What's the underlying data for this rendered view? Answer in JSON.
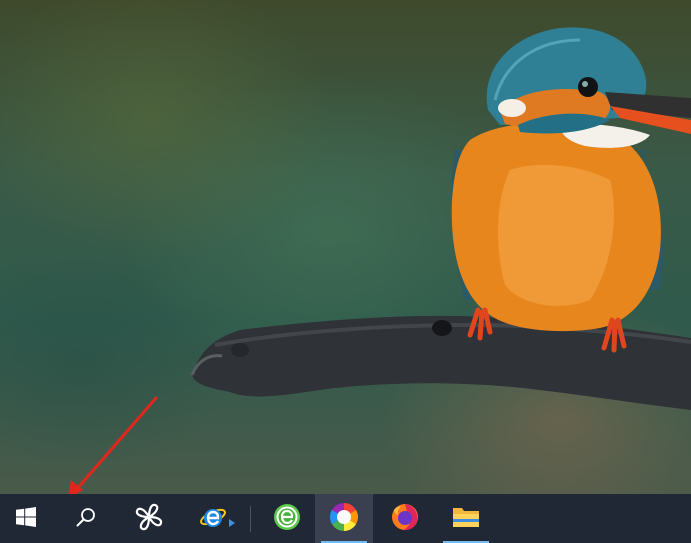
{
  "wallpaper": {
    "subject": "kingfisher-perched-on-branch",
    "palette": {
      "background": "#34543f",
      "bird_orange": "#e8861e",
      "bird_blue": "#2f7f95",
      "branch": "#2f3236"
    }
  },
  "annotation": {
    "color": "#e1261c",
    "points_to": "search-button"
  },
  "taskbar": {
    "background": "#202735",
    "accent": "#76b9ed",
    "items": [
      {
        "name": "start-button",
        "icon": "windows-logo-icon",
        "active": false,
        "running": false
      },
      {
        "name": "search-button",
        "icon": "search-icon",
        "active": false,
        "running": false
      },
      {
        "name": "fan-app-button",
        "icon": "fan-logo-icon",
        "active": false,
        "running": false
      },
      {
        "name": "internet-explorer-button",
        "icon": "internet-explorer-icon",
        "active": false,
        "running": false
      },
      {
        "name": "green-browser-button",
        "icon": "green-e-browser-icon",
        "active": false,
        "running": false
      },
      {
        "name": "colorful-app-button",
        "icon": "colorful-circle-icon",
        "active": true,
        "running": true
      },
      {
        "name": "firefox-button",
        "icon": "firefox-icon",
        "active": false,
        "running": false
      },
      {
        "name": "file-explorer-button",
        "icon": "folder-icon",
        "active": false,
        "running": true
      }
    ]
  }
}
